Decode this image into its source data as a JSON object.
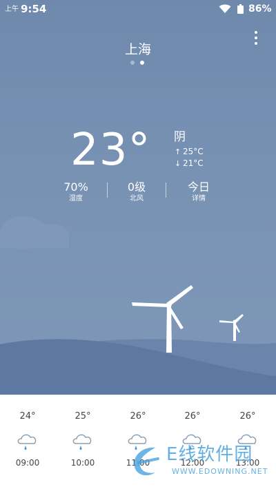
{
  "status_bar": {
    "time_prefix": "上午",
    "time": "9:54",
    "battery": "86%"
  },
  "header": {
    "city": "上海",
    "page_count": 2,
    "active_page": 2
  },
  "current": {
    "temperature": "23°",
    "condition": "阴",
    "high": "25°C",
    "low": "21°C"
  },
  "stats": [
    {
      "value": "70%",
      "label": "湿度"
    },
    {
      "value": "0级",
      "label": "北风"
    },
    {
      "value": "今日",
      "label": "详情"
    }
  ],
  "hourly": [
    {
      "temp": "24°",
      "time": "09:00",
      "icon": "light-rain-icon"
    },
    {
      "temp": "25°",
      "time": "10:00",
      "icon": "light-rain-icon"
    },
    {
      "temp": "26°",
      "time": "11:00",
      "icon": "light-rain-icon"
    },
    {
      "temp": "26°",
      "time": "12:00",
      "icon": "light-rain-icon"
    },
    {
      "temp": "26°",
      "time": "13:00",
      "icon": "light-rain-icon"
    }
  ],
  "watermark": {
    "brand": "E线软件园",
    "url": "WWW.EDOWNING.NET"
  },
  "colors": {
    "sky_top": "#6f89ad",
    "sky_bottom": "#7f98b8",
    "hill_far": "#6a85ab",
    "hill_near": "#5d79a1",
    "rain_drop": "#4a9ad8",
    "cloud_outline": "#8a9db5",
    "watermark": "#4aa3e0"
  }
}
